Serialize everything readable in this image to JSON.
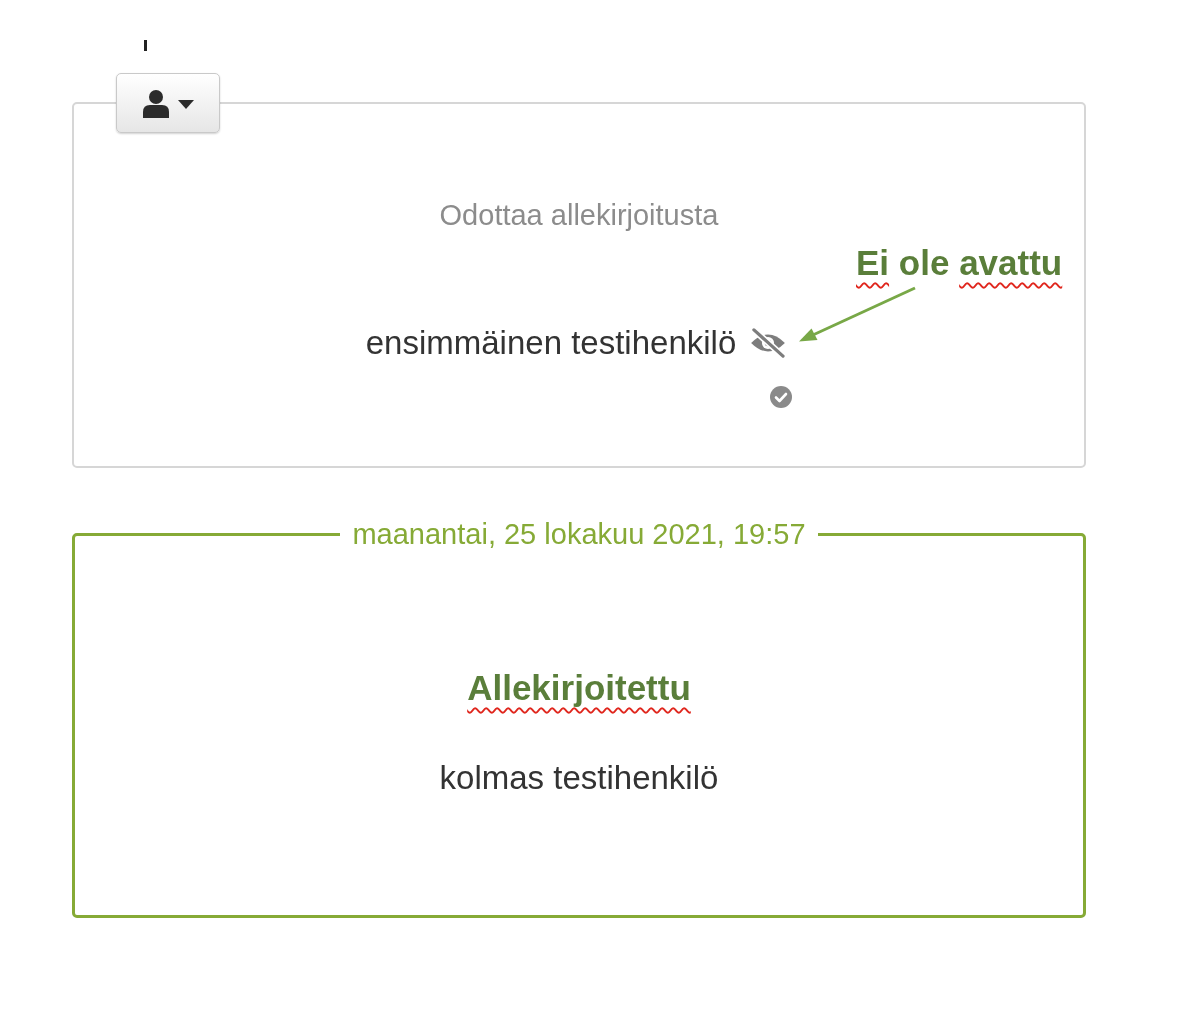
{
  "cards": [
    {
      "kind": "pending",
      "menu_button": true,
      "status": {
        "text": "Odottaa allekirjoitusta",
        "flagged": false
      },
      "signers": [
        {
          "name": "ensimmäinen testihenkilö",
          "opened": false,
          "confirmed": true
        }
      ]
    },
    {
      "kind": "signed",
      "date": "maanantai, 25 lokakuu 2021, 19:57",
      "status": {
        "text": "Allekirjoitettu",
        "flagged": true
      },
      "signers": [
        {
          "name": "kolmas testihenkilö"
        }
      ]
    }
  ],
  "annotation": {
    "kind": "callout",
    "words": [
      {
        "text": "Ei",
        "flagged": true
      },
      {
        "text": "ole",
        "flagged": false
      },
      {
        "text": "avattu",
        "flagged": true
      }
    ]
  }
}
